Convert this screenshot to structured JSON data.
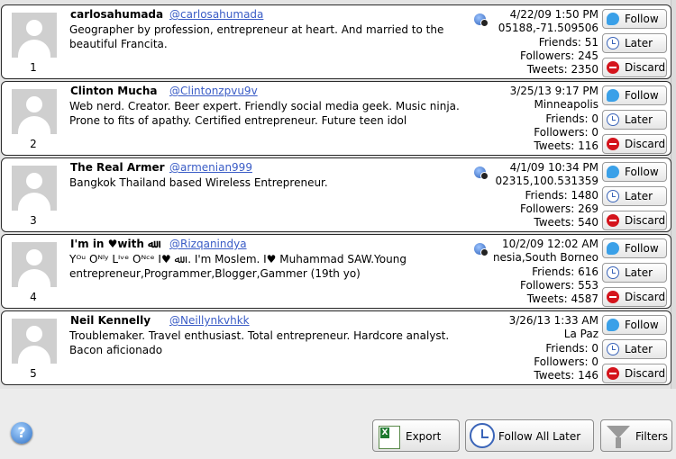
{
  "list": {
    "cards": [
      {
        "index": "1",
        "name": "carlosahumada",
        "handle": "@carlosahumada",
        "bio": "Geographer by profession, entrepreneur at heart. And married to the beautiful Francita.",
        "geo": true,
        "date": "4/22/09 1:50 PM",
        "location": "05188,-71.509506",
        "friends": "Friends: 51",
        "followers": "Followers: 245",
        "tweets": "Tweets: 2350"
      },
      {
        "index": "2",
        "name": "Clinton Mucha",
        "handle": "@Clintonzpvu9v",
        "bio": "Web nerd. Creator. Beer expert. Friendly social media geek. Music ninja. Prone to fits of apathy. Certified entrepreneur. Future teen idol",
        "geo": false,
        "date": "3/25/13 9:17 PM",
        "location": "Minneapolis",
        "friends": "Friends: 0",
        "followers": "Followers: 0",
        "tweets": "Tweets: 116"
      },
      {
        "index": "3",
        "name": "The Real Armer",
        "handle": "@armenian999",
        "bio": "Bangkok Thailand based Wireless Entrepreneur.",
        "geo": true,
        "date": "4/1/09 10:34 PM",
        "location": "02315,100.531359",
        "friends": "Friends: 1480",
        "followers": "Followers: 269",
        "tweets": "Tweets: 540"
      },
      {
        "index": "4",
        "name": "I'm in ♥with ﷲ",
        "handle": "@Rizqanindya",
        "bio": "Yᴼᵘ Oᴺˡʸ Lᴵᵛᵉ Oᴺᶜᵉ I♥ ﷲ. . I'm Moslem. I♥ Muhammad SAW.Young entrepreneur,Programmer,Blogger,Gammer (19th yo)",
        "geo": true,
        "date": "10/2/09 12:02 AM",
        "location": "nesia,South Borneo",
        "friends": "Friends: 616",
        "followers": "Followers: 553",
        "tweets": "Tweets: 4587"
      },
      {
        "index": "5",
        "name": "Neil Kennelly",
        "handle": "@Neillynkvhkk",
        "bio": "Troublemaker. Travel enthusiast. Total entrepreneur. Hardcore analyst. Bacon aficionado",
        "geo": false,
        "date": "3/26/13 1:33 AM",
        "location": "La Paz",
        "friends": "Friends: 0",
        "followers": "Followers: 0",
        "tweets": "Tweets: 146"
      }
    ],
    "follow_label": "Follow",
    "later_label": "Later",
    "discard_label": "Discard"
  },
  "bottom": {
    "help_label": "?",
    "export_label": "Export",
    "follow_all_label": "Follow All Later",
    "filters_label": "Filters"
  },
  "colors": {
    "handle": "#3a5cc6",
    "discard": "#d4141c",
    "follow": "#3aa0e8"
  }
}
